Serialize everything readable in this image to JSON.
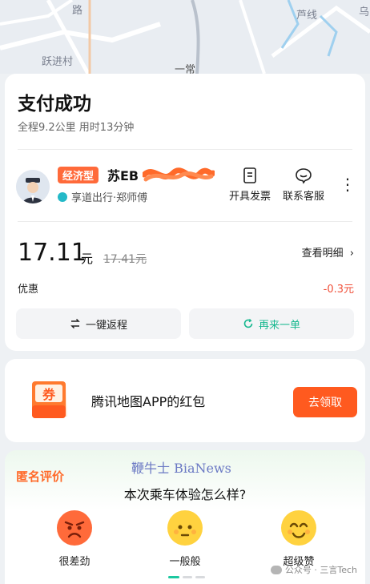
{
  "map": {
    "labels": [
      "跃进村",
      "一常",
      "路",
      "芦线",
      "乌"
    ]
  },
  "trip": {
    "title": "支付成功",
    "subtitle": "全程9.2公里 用时13分钟"
  },
  "driver": {
    "car_type": "经济型",
    "plate": "苏EB",
    "provider": "享道出行·郑师傅"
  },
  "actions": {
    "invoice": "开具发票",
    "service": "联系客服",
    "more": "⋮"
  },
  "payment": {
    "amount": "17.11",
    "unit": "元",
    "original": "17.41元",
    "detail_link": "查看明细",
    "discount_label": "优惠",
    "discount_value": "-0.3元"
  },
  "buttons": {
    "return": "一键返程",
    "again": "再来一单"
  },
  "promo": {
    "icon_text": "券",
    "text": "腾讯地图APP的红包",
    "button": "去领取"
  },
  "rating": {
    "badge": "匿名评价",
    "question": "本次乘车体验怎么样?",
    "options": [
      "很差劲",
      "一般般",
      "超级赞"
    ]
  },
  "watermarks": {
    "bianews": "鞭牛士 BiaNews",
    "wechat": "公众号 · 三言Tech"
  },
  "colors": {
    "accent_orange": "#ff5a1f",
    "green": "#1cc8a0",
    "discount_red": "#f0513b"
  }
}
